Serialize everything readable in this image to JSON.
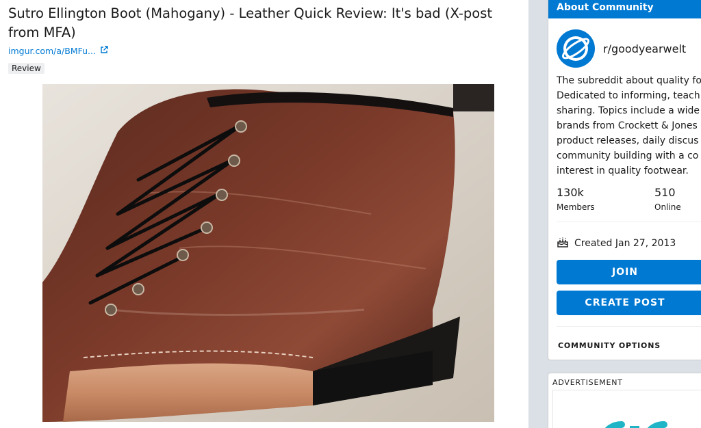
{
  "post": {
    "title": "Sutro Ellington Boot (Mahogany) - Leather Quick Review: It's bad (X-post from MFA)",
    "link_text": "imgur.com/a/BMFu...",
    "flair": "Review"
  },
  "sidebar": {
    "header": "About Community",
    "community_name": "r/goodyearwelt",
    "description_lines": [
      "The subreddit about quality fo",
      "Dedicated to informing, teach",
      "sharing. Topics include a wide",
      "brands from Crockett & Jones",
      "product releases, daily discus",
      "community building with a co",
      "interest in quality footwear."
    ],
    "members_value": "130k",
    "members_label": "Members",
    "online_value": "510",
    "online_label": "Online",
    "created": "Created Jan 27, 2013",
    "join_label": "JOIN",
    "create_post_label": "CREATE POST",
    "community_options_label": "COMMUNITY OPTIONS"
  },
  "ad": {
    "label": "ADVERTISEMENT"
  },
  "colors": {
    "accent": "#0079d3",
    "page_bg": "#dae0e6"
  },
  "icons": {
    "external_link": "external-link-icon",
    "community": "planet-icon",
    "cake": "cake-icon"
  }
}
